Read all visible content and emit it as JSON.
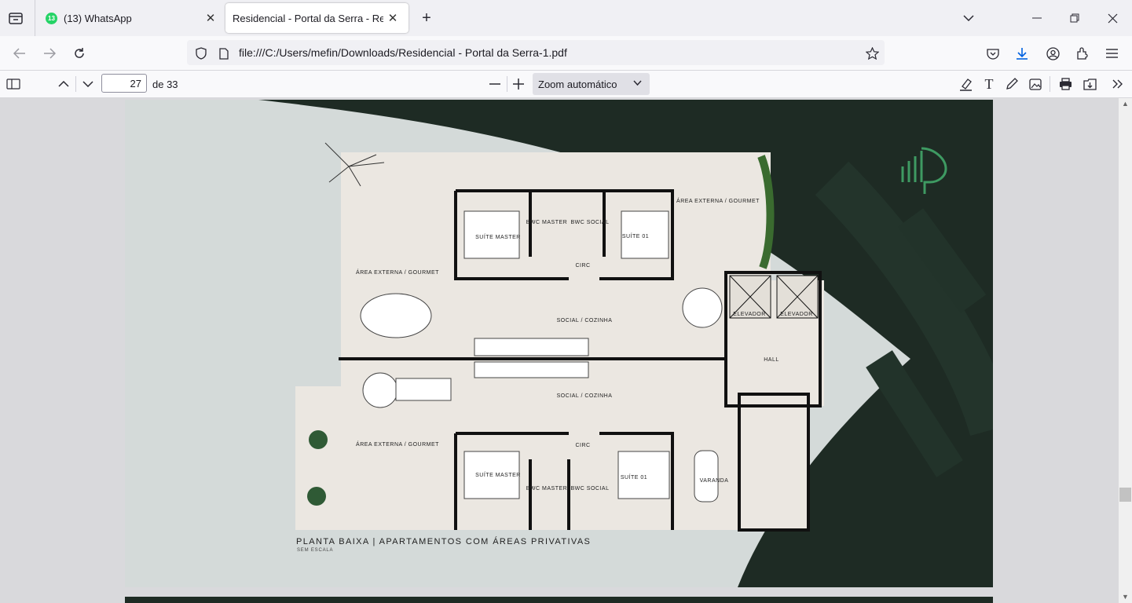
{
  "browser": {
    "tabs": [
      {
        "title": "(13) WhatsApp",
        "badge": "13",
        "active": false
      },
      {
        "title": "Residencial - Portal da Serra - Residencial",
        "active": true
      }
    ],
    "url": "file:///C:/Users/mefin/Downloads/Residencial - Portal da Serra-1.pdf"
  },
  "pdf_toolbar": {
    "page_number": "27",
    "page_total": "de 33",
    "zoom_label": "Zoom automático"
  },
  "floorplan": {
    "title": "PLANTA BAIXA | APARTAMENTOS COM ÁREAS PRIVATIVAS",
    "subtitle": "SEM ESCALA",
    "rooms": {
      "area_externa_top_right": "ÁREA EXTERNA / GOURMET",
      "area_externa_top_left": "ÁREA EXTERNA / GOURMET",
      "area_externa_bottom": "ÁREA EXTERNA / GOURMET",
      "suite_master_top": "SUÍTE MASTER",
      "bwc_master_top": "BWC MASTER",
      "bwc_social_top": "BWC SOCIAL",
      "suite_01_top": "SUÍTE 01",
      "circ_top": "CIRC",
      "social_cozinha_top": "SOCIAL / COZINHA",
      "elevador_1": "ELEVADOR",
      "elevador_2": "ELEVADOR",
      "hall": "HALL",
      "social_cozinha_bottom": "SOCIAL / COZINHA",
      "circ_bottom": "CIRC",
      "suite_master_bottom": "SUÍTE MASTER",
      "bwc_master_bottom": "BWC MASTER",
      "bwc_social_bottom": "BWC SOCIAL",
      "suite_01_bottom": "SUÍTE 01",
      "varanda": "VARANDA"
    }
  }
}
